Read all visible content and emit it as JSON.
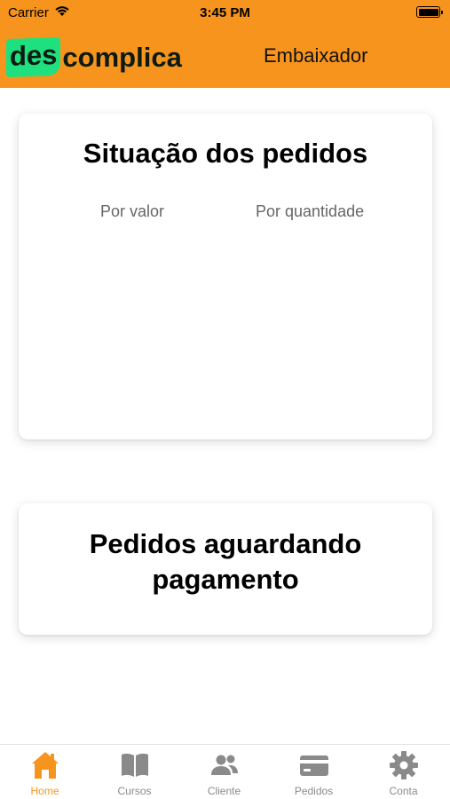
{
  "status_bar": {
    "carrier": "Carrier",
    "time": "3:45 PM"
  },
  "header": {
    "logo_prefix": "des",
    "logo_suffix": "complica",
    "title": "Embaixador",
    "background_color": "#F7941D",
    "logo_accent_color": "#1FE07E"
  },
  "orders_status_card": {
    "title": "Situação dos pedidos",
    "tabs": [
      "Por valor",
      "Por quantidade"
    ]
  },
  "pending_payment_card": {
    "title": "Pedidos aguardando pagamento"
  },
  "tabbar": {
    "active_color": "#F7941D",
    "items": [
      {
        "label": "Home",
        "icon": "home-icon",
        "active": true
      },
      {
        "label": "Cursos",
        "icon": "book-icon",
        "active": false
      },
      {
        "label": "Cliente",
        "icon": "users-icon",
        "active": false
      },
      {
        "label": "Pedidos",
        "icon": "credit-card-icon",
        "active": false
      },
      {
        "label": "Conta",
        "icon": "gear-icon",
        "active": false
      }
    ]
  }
}
